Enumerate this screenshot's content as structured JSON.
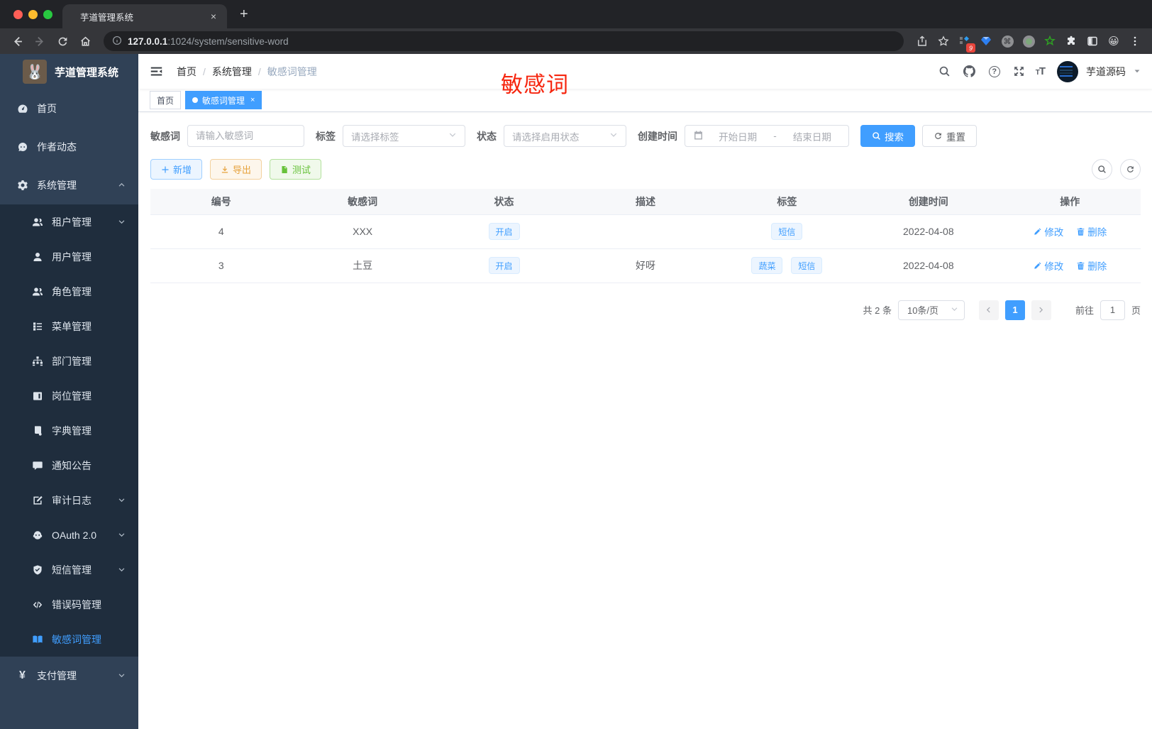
{
  "browser": {
    "tab_title": "芋道管理系统",
    "close_tab": "×",
    "new_tab": "+",
    "url_host": "127.0.0.1",
    "url_path": ":1024/system/sensitive-word",
    "extension_badge": "9"
  },
  "annotation": {
    "text": "敏感词",
    "color": "#f6250e"
  },
  "sidebar": {
    "logo_title": "芋道管理系统",
    "items": [
      {
        "label": "首页"
      },
      {
        "label": "作者动态"
      },
      {
        "label": "系统管理"
      },
      {
        "label": "租户管理"
      },
      {
        "label": "用户管理"
      },
      {
        "label": "角色管理"
      },
      {
        "label": "菜单管理"
      },
      {
        "label": "部门管理"
      },
      {
        "label": "岗位管理"
      },
      {
        "label": "字典管理"
      },
      {
        "label": "通知公告"
      },
      {
        "label": "审计日志"
      },
      {
        "label": "OAuth 2.0"
      },
      {
        "label": "短信管理"
      },
      {
        "label": "错误码管理"
      },
      {
        "label": "敏感词管理"
      },
      {
        "label": "支付管理"
      }
    ]
  },
  "header": {
    "breadcrumb": [
      "首页",
      "系统管理",
      "敏感词管理"
    ],
    "separator": "/",
    "username": "芋道源码"
  },
  "tabs": [
    {
      "label": "首页",
      "active": false
    },
    {
      "label": "敏感词管理",
      "active": true,
      "close": "×"
    }
  ],
  "filters": {
    "word_label": "敏感词",
    "word_placeholder": "请输入敏感词",
    "tag_label": "标签",
    "tag_placeholder": "请选择标签",
    "status_label": "状态",
    "status_placeholder": "请选择启用状态",
    "created_label": "创建时间",
    "start_placeholder": "开始日期",
    "range_separator": "-",
    "end_placeholder": "结束日期",
    "search_label": "搜索",
    "reset_label": "重置"
  },
  "toolbar": {
    "add_label": "新增",
    "export_label": "导出",
    "test_label": "测试"
  },
  "table": {
    "columns": [
      "编号",
      "敏感词",
      "状态",
      "描述",
      "标签",
      "创建时间",
      "操作"
    ],
    "rows": [
      {
        "id": "4",
        "word": "XXX",
        "status": "开启",
        "desc": "",
        "tags": [
          "短信"
        ],
        "created": "2022-04-08",
        "edit": "修改",
        "delete": "删除"
      },
      {
        "id": "3",
        "word": "土豆",
        "status": "开启",
        "desc": "好呀",
        "tags": [
          "蔬菜",
          "短信"
        ],
        "created": "2022-04-08",
        "edit": "修改",
        "delete": "删除"
      }
    ]
  },
  "pagination": {
    "total": "共 2 条",
    "page_size": "10条/页",
    "page": "1",
    "goto": "前往",
    "goto_value": "1",
    "unit": "页"
  },
  "colors": {
    "primary": "#409eff",
    "sidebar_bg": "#304156",
    "submenu_bg": "#1f2d3d"
  }
}
